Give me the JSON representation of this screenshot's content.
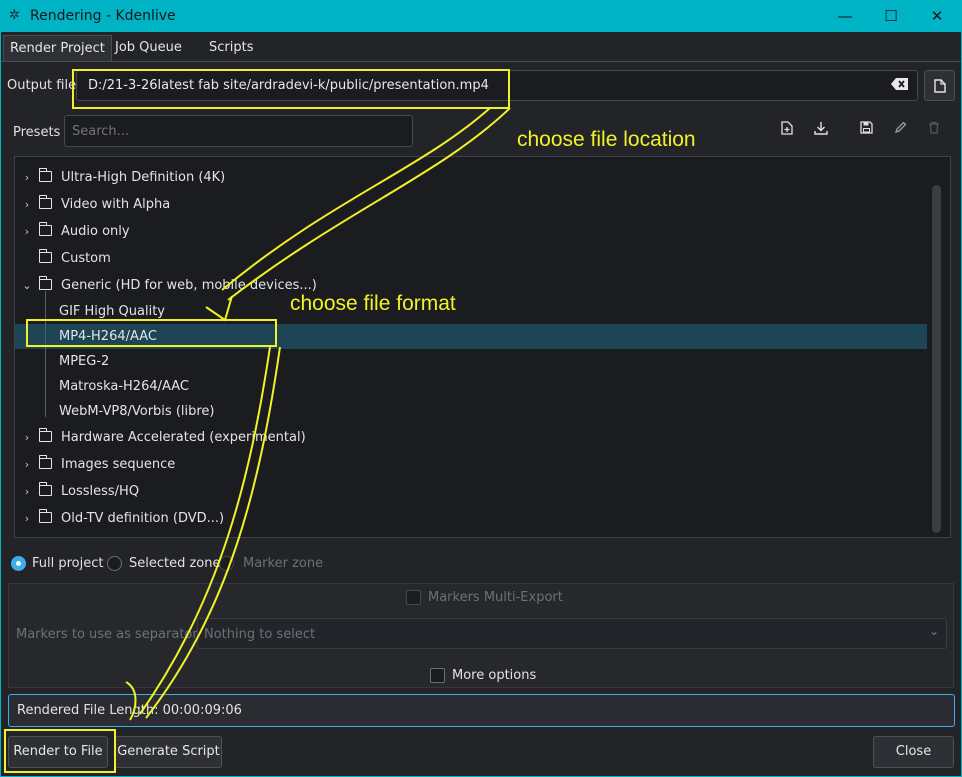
{
  "window": {
    "title": "Rendering - Kdenlive",
    "minimize": "—",
    "maximize": "☐",
    "close": "✕"
  },
  "tabs": [
    {
      "label": "Render Project",
      "active": true
    },
    {
      "label": "Job Queue",
      "active": false
    },
    {
      "label": "Scripts",
      "active": false
    }
  ],
  "output": {
    "label": "Output file",
    "value": "D:/21-3-26latest fab site/ardradevi-k/public/presentation.mp4",
    "clear_icon": "backspace-clear-icon",
    "browse_icon": "open-file-icon"
  },
  "presets": {
    "label": "Presets",
    "search_placeholder": "Search...",
    "toolbar_icons": [
      "new-preset-icon",
      "download-preset-icon",
      "save-preset-icon",
      "edit-preset-icon",
      "delete-preset-icon"
    ]
  },
  "tree": {
    "items": [
      {
        "label": "Ultra-High Definition (4K)",
        "type": "folder",
        "expanded": false
      },
      {
        "label": "Video with Alpha",
        "type": "folder",
        "expanded": false
      },
      {
        "label": "Audio only",
        "type": "folder",
        "expanded": false
      },
      {
        "label": "Custom",
        "type": "folder",
        "expanded": false,
        "no_arrow": true
      },
      {
        "label": "Generic (HD for web, mobile devices...)",
        "type": "folder",
        "expanded": true
      },
      {
        "label": "GIF High Quality",
        "type": "child"
      },
      {
        "label": "MP4-H264/AAC",
        "type": "child",
        "selected": true
      },
      {
        "label": "MPEG-2",
        "type": "child"
      },
      {
        "label": "Matroska-H264/AAC",
        "type": "child"
      },
      {
        "label": "WebM-VP8/Vorbis (libre)",
        "type": "child"
      },
      {
        "label": "Hardware Accelerated (experimental)",
        "type": "folder",
        "expanded": false
      },
      {
        "label": "Images sequence",
        "type": "folder",
        "expanded": false
      },
      {
        "label": "Lossless/HQ",
        "type": "folder",
        "expanded": false
      },
      {
        "label": "Old-TV definition (DVD...)",
        "type": "folder",
        "expanded": false
      }
    ]
  },
  "zone": {
    "full_project": "Full project",
    "selected_zone": "Selected zone",
    "marker_zone": "Marker zone"
  },
  "markers": {
    "multi_export": "Markers Multi-Export",
    "separator_label": "Markers to use as separator",
    "separator_value": "Nothing to select"
  },
  "more_options": "More options",
  "status": "Rendered File Length: 00:00:09:06",
  "buttons": {
    "render": "Render to File",
    "script": "Generate Script",
    "close": "Close"
  },
  "annotations": {
    "location_note": "choose file location",
    "format_note": "choose file format",
    "color": "#f0f227"
  },
  "colors": {
    "accent": "#00b4c6",
    "selection": "#1e4556",
    "radio_checked": "#3daee9"
  }
}
